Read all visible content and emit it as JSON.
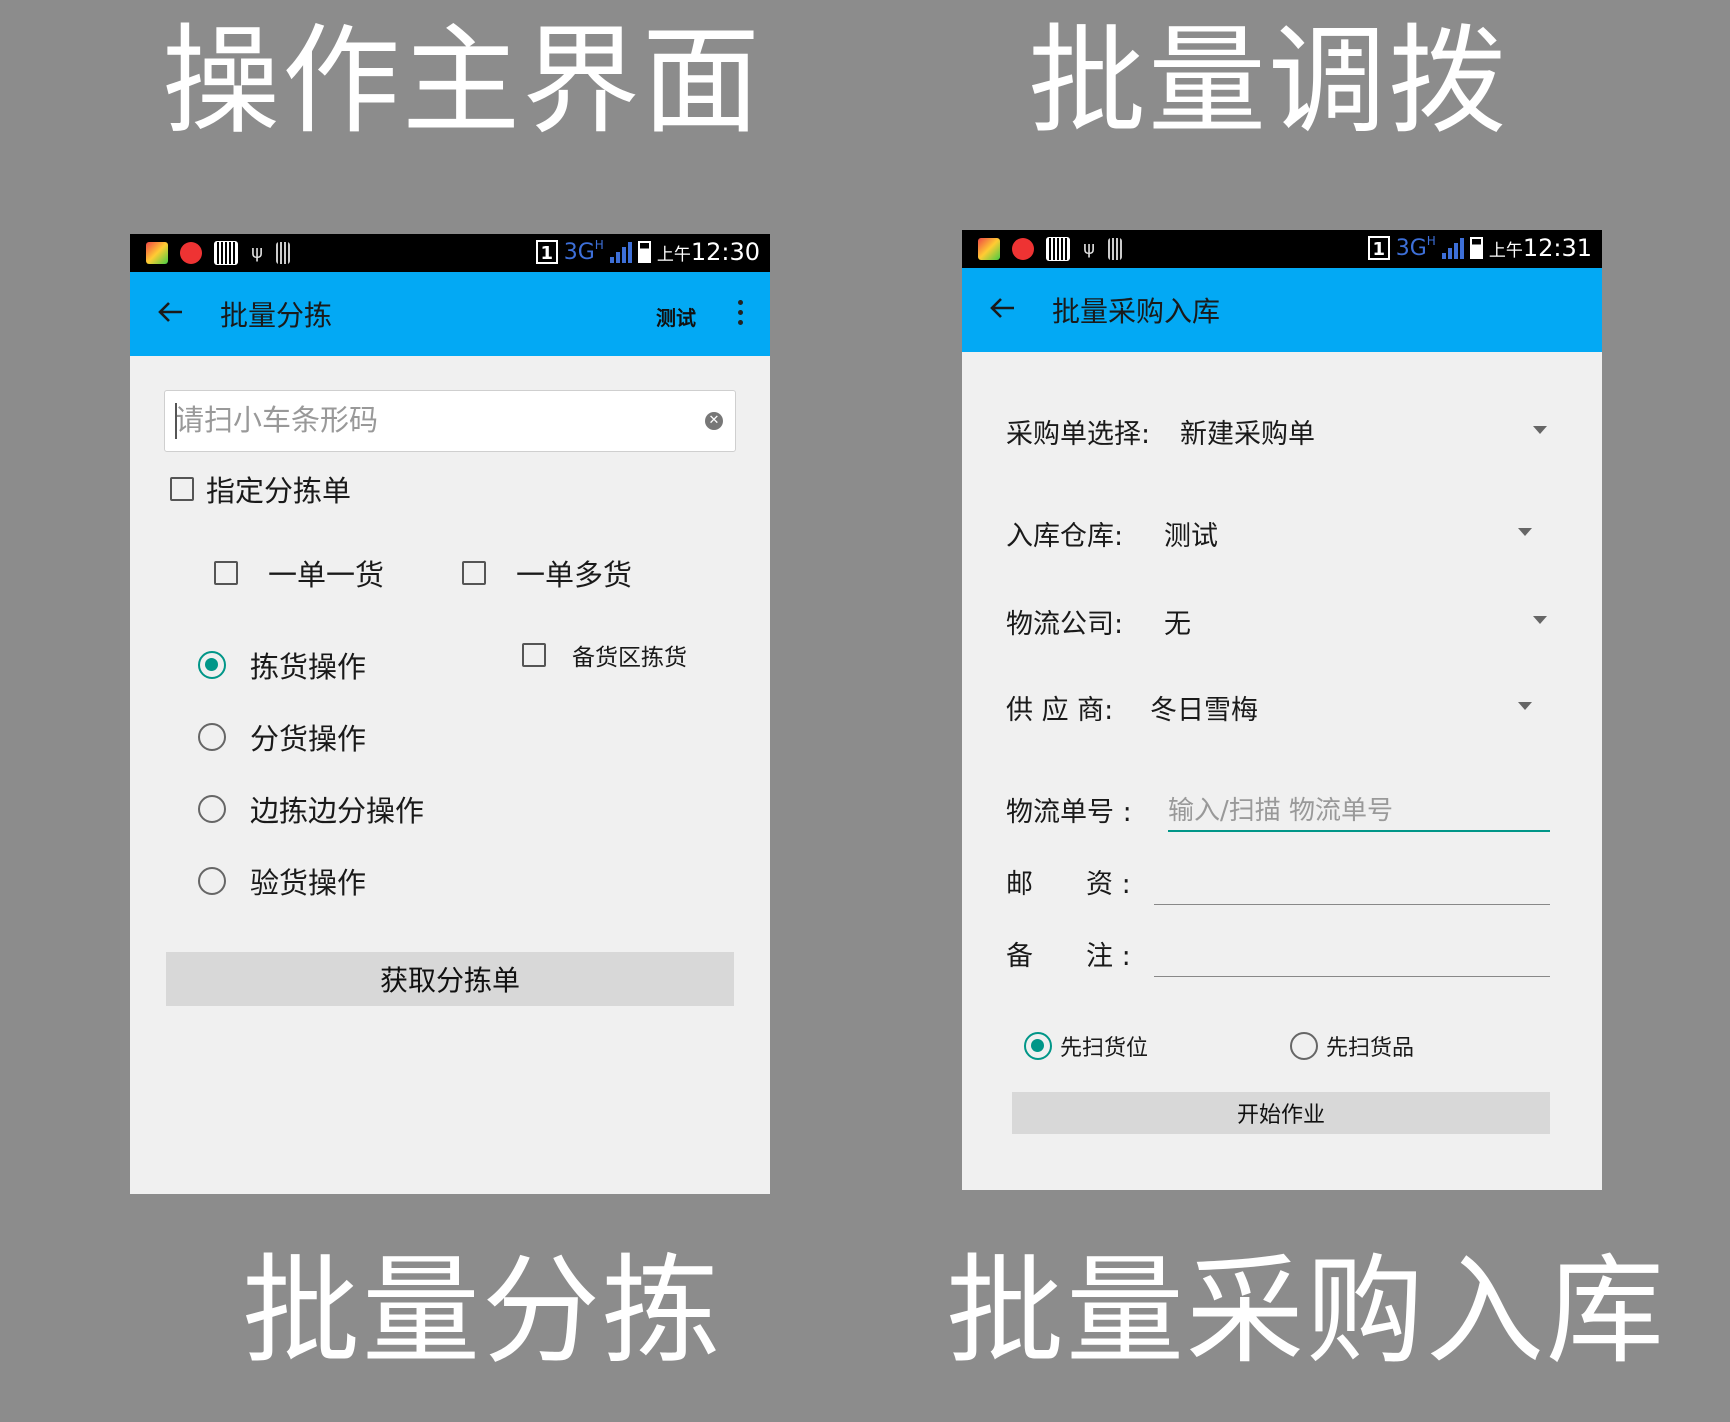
{
  "captions": {
    "top_left": "操作主界面",
    "top_right": "批量调拨",
    "bottom_left": "批量分拣",
    "bottom_right": "批量采购入库"
  },
  "status_left": {
    "sim": "1",
    "network": "3G",
    "net_sub": "H",
    "time_prefix": "上午",
    "time": "12:30"
  },
  "status_right": {
    "sim": "1",
    "network": "3G",
    "net_sub": "H",
    "time_prefix": "上午",
    "time": "12:31"
  },
  "sorting": {
    "title": "批量分拣",
    "action": "测试",
    "search_placeholder": "请扫小车条形码",
    "specify_checkbox": "指定分拣单",
    "single_item": "一单一货",
    "multi_item": "一单多货",
    "ops": [
      "拣货操作",
      "分货操作",
      "边拣边分操作",
      "验货操作"
    ],
    "selected_op": "拣货操作",
    "reserve_area": "备货区拣货",
    "get_button": "获取分拣单"
  },
  "purchase": {
    "title": "批量采购入库",
    "order_label": "采购单选择:",
    "order_value": "新建采购单",
    "warehouse_label": "入库仓库:",
    "warehouse_value": "测试",
    "logistics_label": "物流公司:",
    "logistics_value": "无",
    "supplier_label": "供 应 商:",
    "supplier_value": "冬日雪梅",
    "tracking_label": "物流单号 :",
    "tracking_placeholder": "输入/扫描 物流单号",
    "postage_label_a": "邮",
    "postage_label_b": "资 :",
    "remark_label_a": "备",
    "remark_label_b": "注 :",
    "scan_location": "先扫货位",
    "scan_goods": "先扫货品",
    "selected_scan": "先扫货位",
    "start_button": "开始作业"
  },
  "colors": {
    "background": "#8c8c8c",
    "appbar": "#03a9f4",
    "accent": "#009688",
    "screen": "#f0f0f0"
  }
}
